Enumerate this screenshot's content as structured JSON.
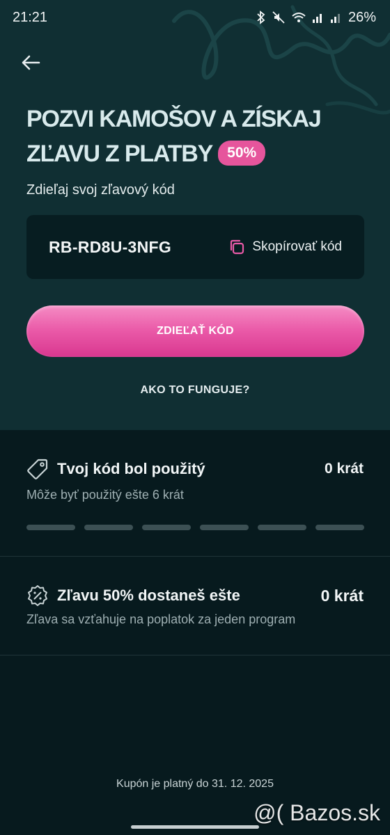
{
  "status_bar": {
    "time": "21:21",
    "battery": "26%"
  },
  "hero": {
    "title_line1": "POZVI KAMOŠOV A ZÍSKAJ",
    "title_line2": "ZĽAVU Z PLATBY",
    "discount_badge": "50%",
    "share_label": "Zdieľaj svoj zľavový kód",
    "code": "RB-RD8U-3NFG",
    "copy_label": "Skopírovať kód",
    "share_button": "ZDIEĽAŤ KÓD",
    "how_link": "AKO TO FUNGUJE?"
  },
  "stats": {
    "used": {
      "title": "Tvoj kód bol použitý",
      "count": "0 krát",
      "subtitle": "Môže byť použitý ešte 6 krát",
      "progress_used": 0,
      "progress_total": 6
    },
    "discount": {
      "title": "Zľavu 50% dostaneš ešte",
      "count": "0 krát",
      "subtitle": "Zľava sa vzťahuje na poplatok za jeden program"
    }
  },
  "validity": "Kupón je platný do 31. 12. 2025",
  "watermark": "@( Bazos.sk",
  "icons": {
    "back": "arrow-left-icon",
    "copy": "copy-icon",
    "tag": "tag-icon",
    "discount": "percent-badge-icon"
  },
  "colors": {
    "hero_bg": "#102f33",
    "page_bg": "#071a1e",
    "accent": "#e6559c"
  }
}
